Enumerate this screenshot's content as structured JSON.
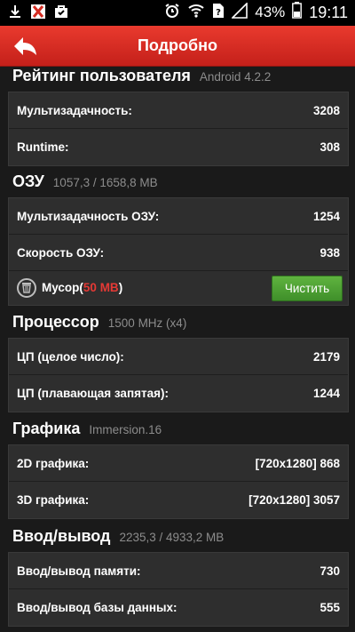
{
  "status_bar": {
    "battery_percent": "43%",
    "time": "19:11"
  },
  "app_bar": {
    "title": "Подробно"
  },
  "sections": {
    "user_rating": {
      "title": "Рейтинг пользователя",
      "subtitle": "Android 4.2.2",
      "rows": [
        {
          "label": "Мультизадачность:",
          "value": "3208"
        },
        {
          "label": "Runtime:",
          "value": "308"
        }
      ]
    },
    "ram": {
      "title": "ОЗУ",
      "subtitle": "1057,3 / 1658,8 MB",
      "rows": [
        {
          "label": "Мультизадачность ОЗУ:",
          "value": "1254"
        },
        {
          "label": "Скорость ОЗУ:",
          "value": "938"
        }
      ],
      "junk": {
        "label": "Мусор",
        "open": "(",
        "size": "50 MB",
        "close": ")",
        "button": "Чистить"
      }
    },
    "cpu": {
      "title": "Процессор",
      "subtitle": "1500 MHz (x4)",
      "rows": [
        {
          "label": "ЦП (целое число):",
          "value": "2179"
        },
        {
          "label": "ЦП (плавающая запятая):",
          "value": "1244"
        }
      ]
    },
    "graphics": {
      "title": "Графика",
      "subtitle": "Immersion.16",
      "rows": [
        {
          "label": "2D графика:",
          "value": "[720x1280] 868"
        },
        {
          "label": "3D графика:",
          "value": "[720x1280] 3057"
        }
      ]
    },
    "io": {
      "title": "Ввод/вывод",
      "subtitle": "2235,3 / 4933,2 MB",
      "rows": [
        {
          "label": "Ввод/вывод памяти:",
          "value": "730"
        },
        {
          "label": "Ввод/вывод базы данных:",
          "value": "555"
        }
      ]
    }
  },
  "colors": {
    "app_bar": "#d42c22",
    "card": "#2e2e2e",
    "background": "#1a1a1a",
    "junk_size": "#e53935",
    "clean_button": "#4ca234"
  }
}
